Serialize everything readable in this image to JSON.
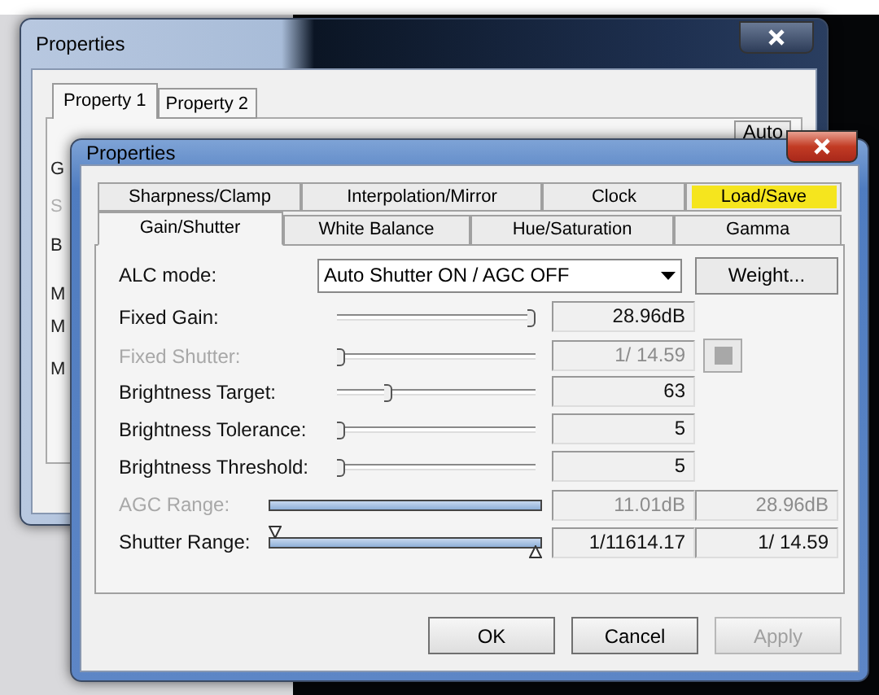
{
  "back_window": {
    "title": "Properties",
    "tabs": [
      {
        "label": "Property 1",
        "selected": true
      },
      {
        "label": "Property 2",
        "selected": false
      }
    ],
    "auto_button": "Auto",
    "row_labels": [
      {
        "text": "G",
        "disabled": false
      },
      {
        "text": "S",
        "disabled": true
      },
      {
        "text": "B",
        "disabled": false
      },
      {
        "text": "M",
        "disabled": false
      },
      {
        "text": "M",
        "disabled": false
      },
      {
        "text": "M",
        "disabled": false
      }
    ]
  },
  "window": {
    "title": "Properties"
  },
  "tab_rows": [
    [
      {
        "label": "Sharpness/Clamp",
        "selected": false,
        "highlighted": false
      },
      {
        "label": "Interpolation/Mirror",
        "selected": false,
        "highlighted": false
      },
      {
        "label": "Clock",
        "selected": false,
        "highlighted": false
      },
      {
        "label": "Load/Save",
        "selected": false,
        "highlighted": true
      }
    ],
    [
      {
        "label": "Gain/Shutter",
        "selected": true,
        "highlighted": false
      },
      {
        "label": "White Balance",
        "selected": false,
        "highlighted": false
      },
      {
        "label": "Hue/Saturation",
        "selected": false,
        "highlighted": false
      },
      {
        "label": "Gamma",
        "selected": false,
        "highlighted": false
      }
    ]
  ],
  "alc_mode": {
    "label": "ALC mode:",
    "value": "Auto Shutter ON / AGC OFF",
    "button": "Weight..."
  },
  "controls": [
    {
      "kind": "slider",
      "label": "Fixed Gain:",
      "disabled": false,
      "level": 1,
      "value": "28.96dB",
      "toggle": false
    },
    {
      "kind": "slider",
      "label": "Fixed Shutter:",
      "disabled": true,
      "level": 0,
      "value": "1/ 14.59",
      "toggle": true
    },
    {
      "kind": "slider",
      "label": "Brightness Target:",
      "disabled": false,
      "level": 0.25,
      "value": "63",
      "toggle": false
    },
    {
      "kind": "slider",
      "label": "Brightness Tolerance:",
      "disabled": false,
      "level": 0,
      "value": "5",
      "toggle": false
    },
    {
      "kind": "slider",
      "label": "Brightness Threshold:",
      "disabled": false,
      "level": 0,
      "value": "5",
      "toggle": false
    },
    {
      "kind": "range",
      "label": "AGC Range:",
      "disabled": true,
      "handles": false,
      "low": "11.01dB",
      "high": "28.96dB"
    },
    {
      "kind": "range",
      "label": "Shutter Range:",
      "disabled": false,
      "handles": true,
      "low": "1/11614.17",
      "high": "1/ 14.59"
    }
  ],
  "buttons": [
    {
      "label": "OK",
      "disabled": false
    },
    {
      "label": "Cancel",
      "disabled": false
    },
    {
      "label": "Apply",
      "disabled": true
    }
  ]
}
